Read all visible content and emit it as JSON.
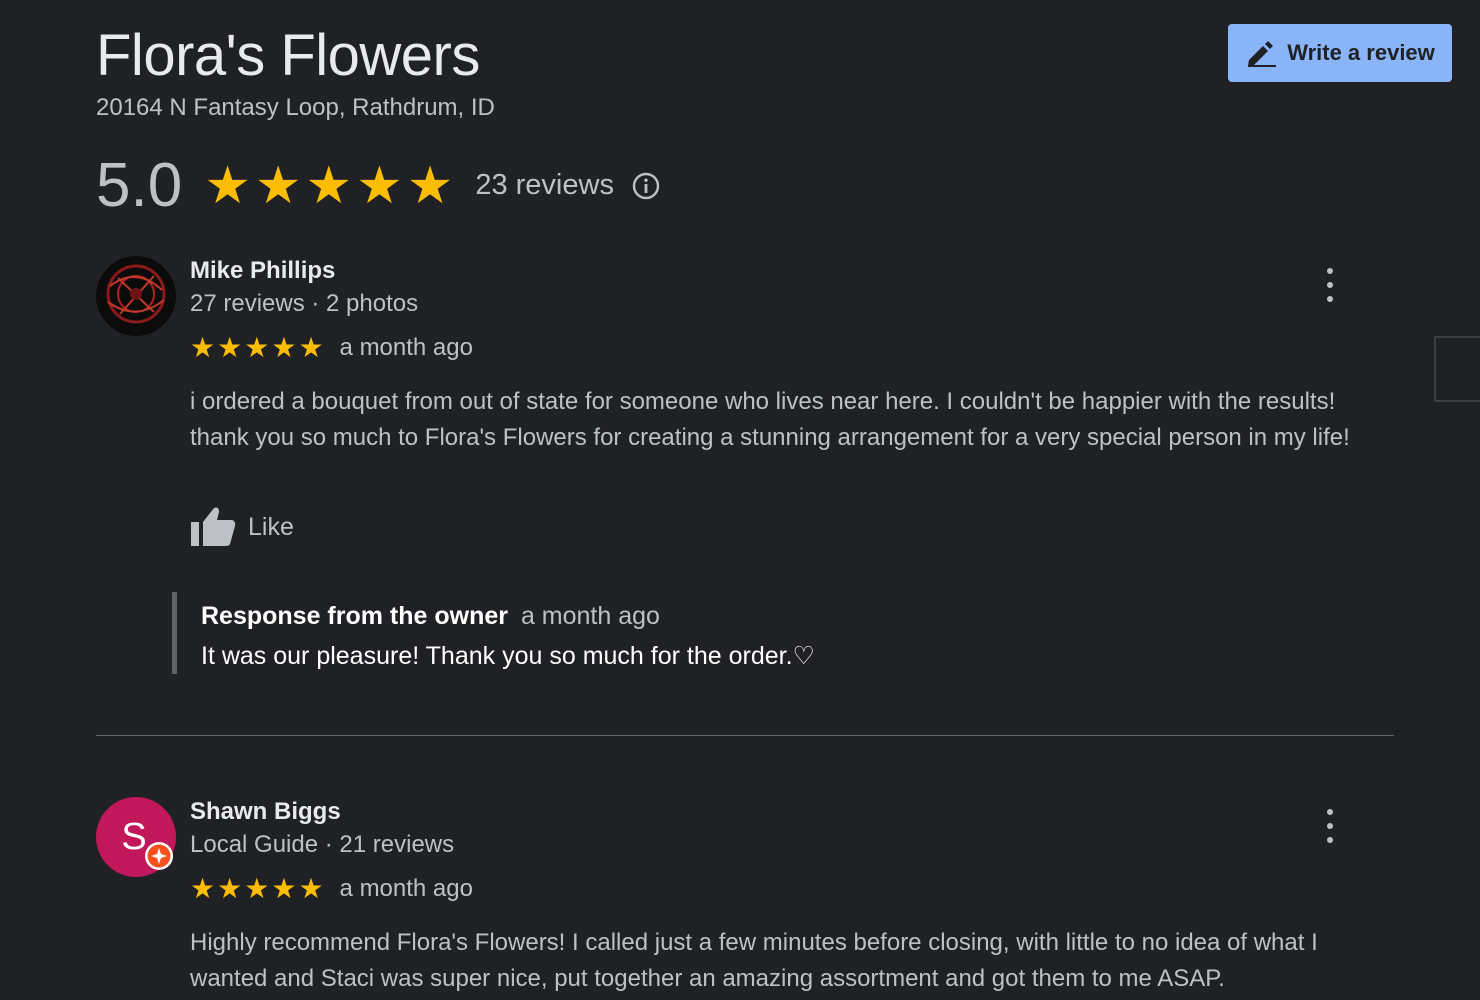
{
  "business": {
    "name": "Flora's Flowers",
    "address": "20164 N Fantasy Loop, Rathdrum, ID",
    "rating": "5.0",
    "review_count": "23 reviews",
    "write_review_label": "Write a review"
  },
  "colors": {
    "star": "#fbbc04",
    "accent": "#8ab4f8",
    "background": "#202124"
  },
  "icons": [
    "pencil-icon",
    "info-icon",
    "more-vert-icon",
    "thumb-up-icon",
    "local-guide-badge-icon"
  ],
  "reviews": [
    {
      "name": "Mike Phillips",
      "meta": "27 reviews · 2 photos",
      "rating": 5,
      "time": "a month ago",
      "text": "i ordered a bouquet from out of state for someone who lives near here. I couldn't be happier with the results! thank you so much to Flora's Flowers for creating a stunning arrangement for a very special person in my life!",
      "like_label": "Like",
      "owner_response": {
        "title": "Response from the owner",
        "time": "a month ago",
        "text": "It was our pleasure! Thank you so much for the order.♡"
      }
    },
    {
      "name": "Shawn Biggs",
      "meta": "Local Guide · 21 reviews",
      "avatar_letter": "S",
      "rating": 5,
      "time": "a month ago",
      "text": "Highly recommend Flora's Flowers! I called just a few minutes before closing, with little to no idea of what I wanted and Staci was super nice, put together an amazing assortment and got them to me ASAP."
    }
  ]
}
